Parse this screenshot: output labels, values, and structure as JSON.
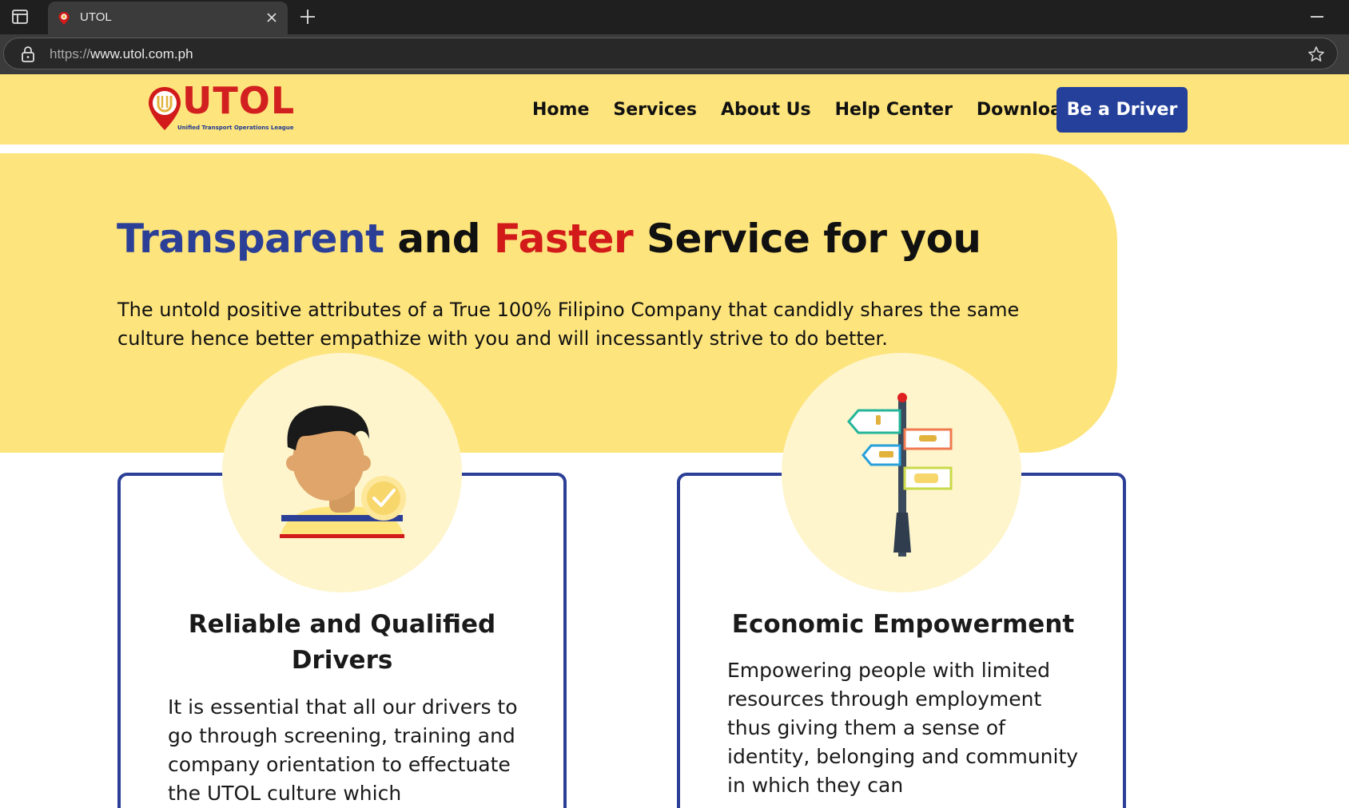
{
  "browser": {
    "tab_title": "UTOL",
    "url_protocol": "https://",
    "url_host": "www.utol.com.ph"
  },
  "header": {
    "logo_text": "UTOL",
    "logo_subtitle": "Unified Transport Operations League",
    "nav": [
      "Home",
      "Services",
      "About Us",
      "Help Center",
      "Download"
    ],
    "cta_label": "Be a Driver"
  },
  "hero": {
    "title_part1": "Transparent",
    "title_part2": " and ",
    "title_part3": "Faster",
    "title_part4": " Service for you",
    "description": "The untold positive attributes of a True 100% Filipino Company that candidly shares the same culture hence better empathize with you and will incessantly strive to do better."
  },
  "cards": [
    {
      "title": "Reliable and Qualified Drivers",
      "text": "It is essential that all our drivers to go through screening, training and company orientation to effectuate the UTOL culture which"
    },
    {
      "title": "Economic Empowerment",
      "text": "Empowering people with limited resources through employment thus giving them a sense of identity, belonging and community in which they can"
    }
  ],
  "colors": {
    "brand_yellow": "#fde47c",
    "brand_blue": "#2c3f97",
    "brand_red": "#d21a1a"
  },
  "icons": [
    "sidebar-toggle-icon",
    "favicon-icon",
    "close-icon",
    "plus-icon",
    "lock-icon",
    "star-icon",
    "driver-avatar-icon",
    "checkmark-badge-icon",
    "signpost-icon"
  ]
}
